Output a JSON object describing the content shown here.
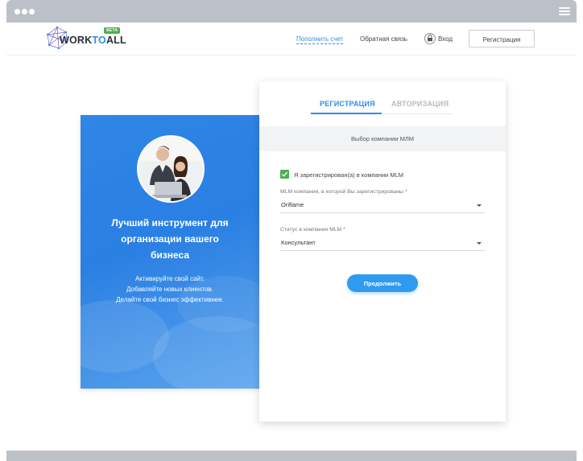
{
  "window": {
    "controls": [
      "dot",
      "dot",
      "dot"
    ],
    "menu_icon": "hamburger-icon"
  },
  "header": {
    "logo": {
      "part1": "WORK",
      "part2": "TO",
      "part3": "ALL",
      "badge": "BETA"
    },
    "nav": {
      "topup": "Пополнить счет",
      "feedback": "Обратная связь",
      "login": "Вход"
    },
    "register_button": "Регистрация",
    "accent_color": "#2f8df0"
  },
  "promo": {
    "title_lines": [
      "Лучший инструмент для",
      "организации вашего",
      "бизнеса"
    ],
    "lines": [
      "Активируйте свой сайт.",
      "Добавляйте новых клиентов.",
      "Делайте свой бизнес эффективнее."
    ],
    "background_color": "#2f86e6"
  },
  "form": {
    "tabs": [
      {
        "label": "РЕГИСТРАЦИЯ",
        "active": true
      },
      {
        "label": "АВТОРИЗАЦИЯ",
        "active": false
      }
    ],
    "section_title": "Выбор компании МЛМ",
    "checkbox": {
      "label": "Я зарегистрирован(а) в компании MLM",
      "checked": true,
      "color": "#4caf50"
    },
    "fields": [
      {
        "label": "MLM компания, в которой Вы зарегистрированы",
        "required_mark": "*",
        "value": "Oriflame"
      },
      {
        "label": "Статус в компании MLM",
        "required_mark": "*",
        "value": "Консультант"
      }
    ],
    "continue_button": "Продолжить"
  }
}
